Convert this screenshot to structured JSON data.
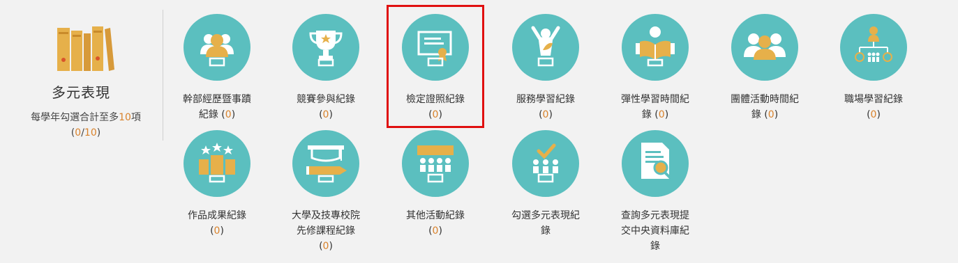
{
  "summary": {
    "title": "多元表現",
    "desc_prefix": "每學年勾選合計至多",
    "max": "10",
    "desc_suffix": "項",
    "selected": "0",
    "icon": "books-icon"
  },
  "items": [
    {
      "id": "cadre",
      "line1": "幹部經歷暨事蹟",
      "line2": "紀錄 (",
      "count": "0",
      "close": ")",
      "icon": "cadre-person-icon"
    },
    {
      "id": "competition",
      "line1": "競賽參與紀錄",
      "line2": "(",
      "count": "0",
      "close": ")",
      "icon": "trophy-icon"
    },
    {
      "id": "certificate",
      "line1": "檢定證照紀錄",
      "line2": "(",
      "count": "0",
      "close": ")",
      "icon": "certificate-icon"
    },
    {
      "id": "service",
      "line1": "服務學習紀錄",
      "line2": "(",
      "count": "0",
      "close": ")",
      "icon": "service-person-icon"
    },
    {
      "id": "flexible",
      "line1": "彈性學習時間紀",
      "line2": "錄 (",
      "count": "0",
      "close": ")",
      "icon": "reading-person-icon"
    },
    {
      "id": "group",
      "line1": "團體活動時間紀",
      "line2": "錄 (",
      "count": "0",
      "close": ")",
      "icon": "group-icon"
    },
    {
      "id": "workplace",
      "line1": "職場學習紀錄",
      "line2": "(",
      "count": "0",
      "close": ")",
      "icon": "org-chart-icon"
    },
    {
      "id": "works",
      "line1": "作品成果紀錄",
      "line2": "(",
      "count": "0",
      "close": ")",
      "icon": "stars-podium-icon"
    },
    {
      "id": "advanced",
      "line1": "大學及技專校院",
      "line2": "先修課程紀錄",
      "line3": "(",
      "count": "0",
      "close": ")",
      "icon": "graduation-pencil-icon"
    },
    {
      "id": "other",
      "line1": "其他活動紀錄",
      "line2": "(",
      "count": "0",
      "close": ")",
      "icon": "audience-icon"
    },
    {
      "id": "select",
      "line1": "勾選多元表現紀",
      "line2": "錄",
      "icon": "check-audience-icon"
    },
    {
      "id": "query",
      "line1": "查詢多元表現提",
      "line2": "交中央資料庫紀",
      "line3": "錄",
      "icon": "document-search-icon"
    }
  ],
  "colors": {
    "circle": "#5bbfbf",
    "accent": "#e6b04a",
    "count": "#d9822b",
    "highlight": "#e01010"
  }
}
